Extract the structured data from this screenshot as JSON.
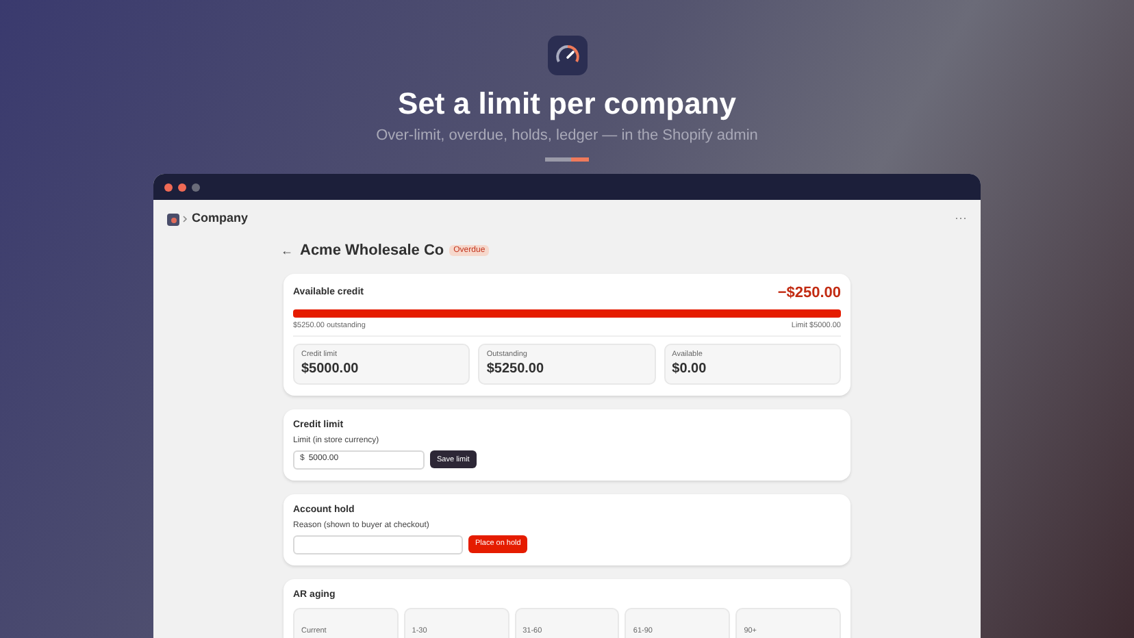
{
  "hero": {
    "title": "Set a limit per company",
    "subtitle": "Over-limit, overdue, holds, ledger — in the Shopify admin"
  },
  "window": {
    "breadcrumb": "Company",
    "more": "···"
  },
  "page": {
    "back": "←",
    "title": "Acme Wholesale Co",
    "badge": "Overdue"
  },
  "available_credit": {
    "title": "Available credit",
    "amount": "−$250.00",
    "level": 1,
    "outstanding_note": "$5250.00 outstanding",
    "limit_note": "Limit $5000.00",
    "stats": [
      {
        "label": "Credit limit",
        "value": "$5000.00"
      },
      {
        "label": "Outstanding",
        "value": "$5250.00"
      },
      {
        "label": "Available",
        "value": "$0.00"
      }
    ]
  },
  "credit_limit": {
    "title": "Credit limit",
    "field_label": "Limit (in store currency)",
    "prefix": "$",
    "value": "5000.00",
    "button": "Save limit"
  },
  "account_hold": {
    "title": "Account hold",
    "field_label": "Reason (shown to buyer at checkout)",
    "button": "Place on hold"
  },
  "ar_aging": {
    "title": "AR aging",
    "buckets": [
      "Current",
      "1-30",
      "31-60",
      "61-90",
      "90+"
    ]
  }
}
